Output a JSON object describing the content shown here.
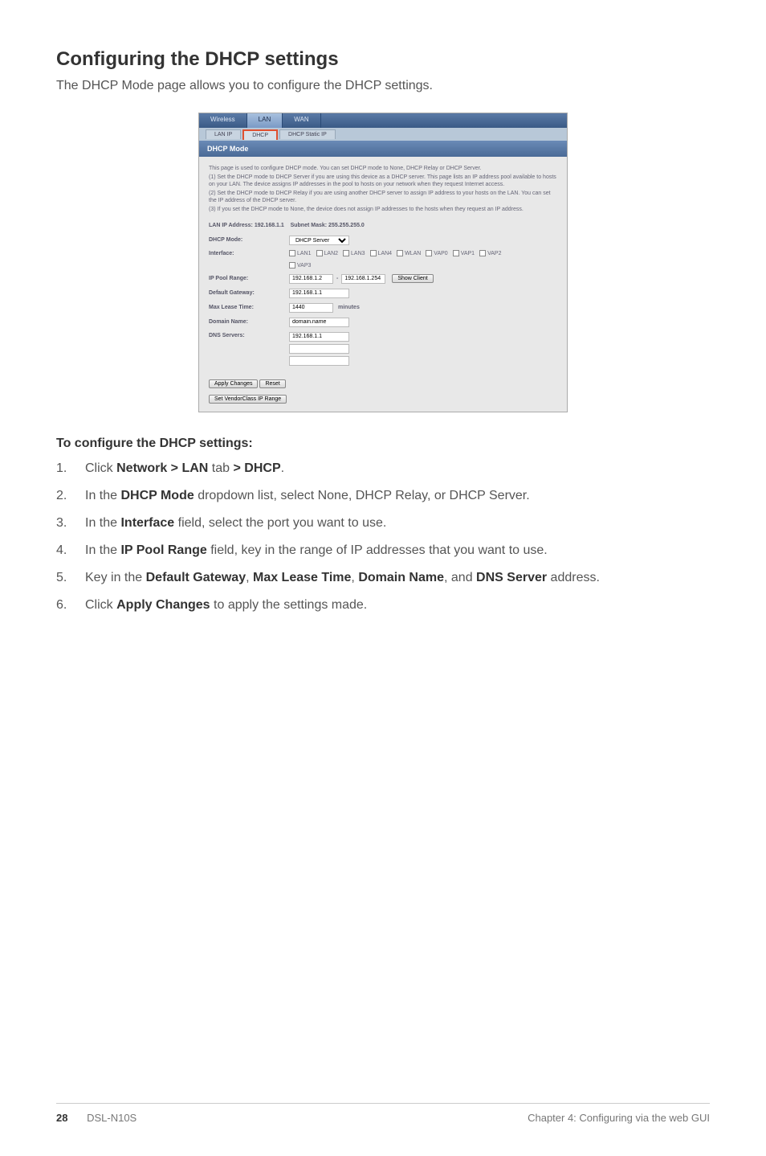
{
  "page": {
    "heading": "Configuring the DHCP settings",
    "intro": "The DHCP Mode page allows you to configure the DHCP settings."
  },
  "screenshot": {
    "tabs": {
      "wireless": "Wireless",
      "lan": "LAN",
      "wan": "WAN"
    },
    "subtabs": {
      "lanip": "LAN IP",
      "dhcp": "DHCP",
      "static": "DHCP Static IP"
    },
    "panel_title": "DHCP Mode",
    "desc_line1": "This page is used to configure DHCP mode. You can set DHCP mode to None, DHCP Relay or DHCP Server.",
    "desc_line2": "(1) Set the DHCP mode to DHCP Server if you are using this device as a DHCP server. This page lists an IP address pool available to hosts on your LAN. The device assigns IP addresses in the pool to hosts on your network when they request Internet access.",
    "desc_line3": "(2) Set the DHCP mode to DHCP Relay if you are using another DHCP server to assign IP address to your hosts on the LAN. You can set the IP address of the DHCP server.",
    "desc_line4": "(3) If you set the DHCP mode to None, the device does not assign IP addresses to the hosts when they request an IP address.",
    "lan_ip_label": "LAN IP Address:",
    "lan_ip_value": "192.168.1.1",
    "subnet_label": "Subnet Mask:",
    "subnet_value": "255.255.255.0",
    "fields": {
      "dhcp_mode": {
        "label": "DHCP Mode:",
        "value": "DHCP Server"
      },
      "interface": {
        "label": "Interface:",
        "options": [
          "LAN1",
          "LAN2",
          "LAN3",
          "LAN4",
          "WLAN",
          "VAP0",
          "VAP1",
          "VAP2",
          "VAP3"
        ]
      },
      "ip_pool_range": {
        "label": "IP Pool Range:",
        "from": "192.168.1.2",
        "dash": "-",
        "to": "192.168.1.254",
        "btn": "Show Client"
      },
      "default_gateway": {
        "label": "Default Gateway:",
        "value": "192.168.1.1"
      },
      "max_lease": {
        "label": "Max Lease Time:",
        "value": "1440",
        "unit": "minutes"
      },
      "domain_name": {
        "label": "Domain Name:",
        "value": "domain.name"
      },
      "dns_servers": {
        "label": "DNS Servers:",
        "value1": "192.168.1.1",
        "value2": "",
        "value3": ""
      }
    },
    "buttons": {
      "apply": "Apply Changes",
      "reset": "Reset",
      "vendor": "Set VendorClass IP Range"
    }
  },
  "instructions": {
    "heading": "To configure the DHCP settings:",
    "steps": [
      {
        "num": "1.",
        "pre": "Click ",
        "bold": "Network > LAN",
        "mid": " tab ",
        "bold2": "> DHCP",
        "post": "."
      },
      {
        "num": "2.",
        "pre": "In the ",
        "bold": "DHCP Mode",
        "post": " dropdown list, select None, DHCP Relay, or DHCP Server."
      },
      {
        "num": "3.",
        "pre": "In the ",
        "bold": "Interface",
        "post": " field, select the port you want to use."
      },
      {
        "num": "4.",
        "pre": "In the ",
        "bold": "IP Pool Range",
        "post": " field, key in the range of IP addresses that you want to use."
      },
      {
        "num": "5.",
        "pre": "Key in the ",
        "bold": "Default Gateway",
        "mid": ", ",
        "bold2": "Max Lease Time",
        "mid2": ", ",
        "bold3": "Domain Name",
        "mid3": ", and ",
        "bold4": "DNS Server",
        "post": " address."
      },
      {
        "num": "6.",
        "pre": "Click ",
        "bold": "Apply Changes",
        "post": " to apply the settings made."
      }
    ]
  },
  "footer": {
    "page_num": "28",
    "model": "DSL-N10S",
    "chapter": "Chapter 4: Configuring via the web GUI"
  }
}
